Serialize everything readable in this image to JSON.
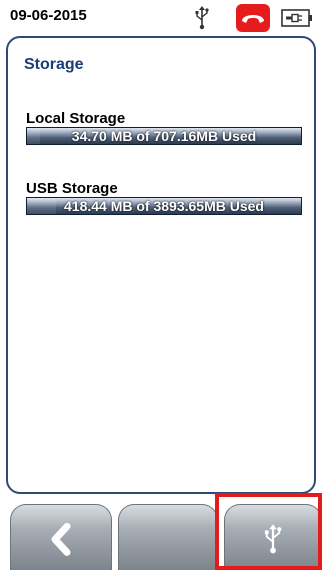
{
  "status_bar": {
    "date": "09-06-2015",
    "icons": [
      "usb-icon",
      "hang-up-phone-icon",
      "battery-icon"
    ],
    "call_icon_color": "#e51c1c"
  },
  "panel": {
    "title": "Storage",
    "border_color": "#2e4a74",
    "title_color": "#1b3d78"
  },
  "local_storage": {
    "label": "Local Storage",
    "usage_text": "34.70 MB of 707.16MB Used",
    "used_mb": 34.7,
    "total_mb": 707.16
  },
  "usb_storage": {
    "label": "USB Storage",
    "usage_text": "418.44 MB of 3893.65MB Used",
    "used_mb": 418.44,
    "total_mb": 3893.65
  },
  "soft_buttons": [
    {
      "icon": "chevron-left-icon"
    },
    {
      "icon": ""
    },
    {
      "icon": "usb-icon"
    }
  ],
  "highlight_color": "#e31b1b"
}
